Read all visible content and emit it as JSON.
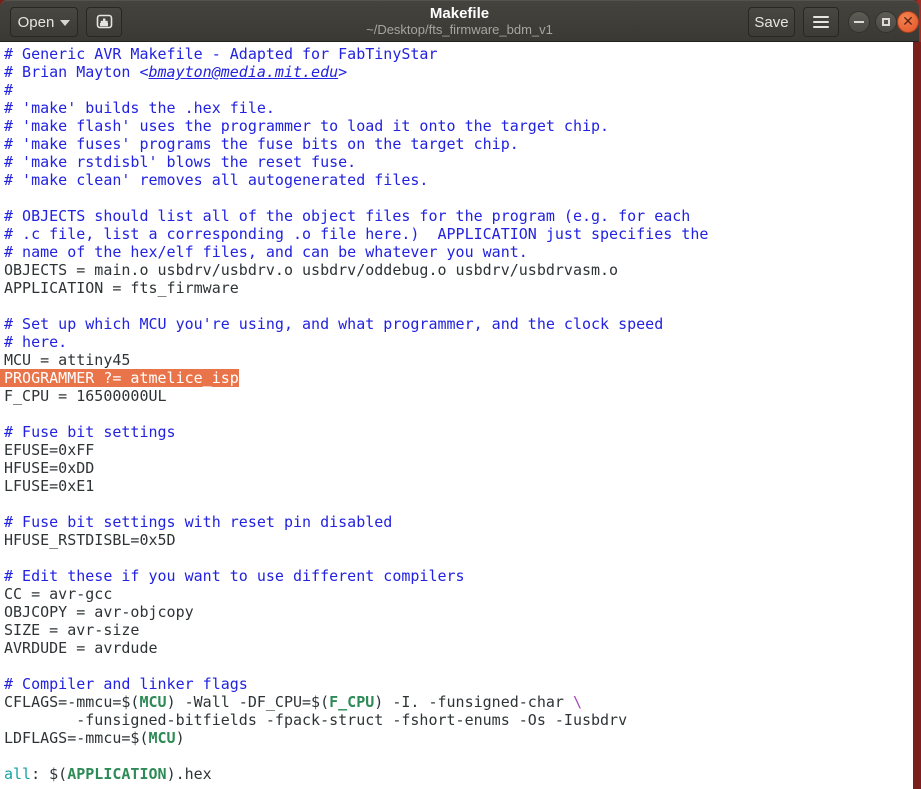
{
  "window": {
    "title": "Makefile",
    "subtitle": "~/Desktop/fts_firmware_bdm_v1",
    "open_button_label": "Open",
    "save_button_label": "Save",
    "toolbar_icons": [
      "caret-down-icon",
      "new-document-icon",
      "menu-icon"
    ],
    "window_controls": [
      "minimize",
      "maximize",
      "close"
    ]
  },
  "colors": {
    "comment_color": "#2222e0",
    "plain_color": "#2e3436",
    "var_color": "#2e8b57",
    "target_color": "#17a2a2",
    "esc_color": "#a347ba",
    "selection_color": "#ea744a",
    "desktop_red": "#7a201a",
    "header_bg": "#3d3b36",
    "close_button_orange": "#e8633f"
  },
  "code": {
    "selected_text": "PROGRAMMER ?= atmelice_isp",
    "lines": [
      [
        {
          "t": "# Generic AVR Makefile - Adapted for FabTinyStar",
          "c": "comment"
        }
      ],
      [
        {
          "t": "# Brian Mayton <",
          "c": "comment"
        },
        {
          "t": "bmayton@media.mit.edu",
          "c": "email"
        },
        {
          "t": ">",
          "c": "comment"
        }
      ],
      [
        {
          "t": "#",
          "c": "comment"
        }
      ],
      [
        {
          "t": "# 'make' builds the .hex file.",
          "c": "comment"
        }
      ],
      [
        {
          "t": "# 'make flash' uses the programmer to load it onto the target chip.",
          "c": "comment"
        }
      ],
      [
        {
          "t": "# 'make fuses' programs the fuse bits on the target chip.",
          "c": "comment"
        }
      ],
      [
        {
          "t": "# 'make rstdisbl' blows the reset fuse.",
          "c": "comment"
        }
      ],
      [
        {
          "t": "# 'make clean' removes all autogenerated files.",
          "c": "comment"
        }
      ],
      [],
      [
        {
          "t": "# OBJECTS should list all of the object files for the program (e.g. for each",
          "c": "comment"
        }
      ],
      [
        {
          "t": "# .c file, list a corresponding .o file here.)  APPLICATION just specifies the",
          "c": "comment"
        }
      ],
      [
        {
          "t": "# name of the hex/elf files, and can be whatever you want.",
          "c": "comment"
        }
      ],
      [
        {
          "t": "OBJECTS = main.o usbdrv/usbdrv.o usbdrv/oddebug.o usbdrv/usbdrvasm.o",
          "c": "plain"
        }
      ],
      [
        {
          "t": "APPLICATION = fts_firmware",
          "c": "plain"
        }
      ],
      [],
      [
        {
          "t": "# Set up which MCU you're using, and what programmer, and the clock speed",
          "c": "comment"
        }
      ],
      [
        {
          "t": "# here.",
          "c": "comment"
        }
      ],
      [
        {
          "t": "MCU = attiny45",
          "c": "plain"
        }
      ],
      [
        {
          "t": "PROGRAMMER ?= atmelice_isp",
          "c": "hl"
        }
      ],
      [
        {
          "t": "F_CPU = 16500000UL",
          "c": "plain"
        }
      ],
      [],
      [
        {
          "t": "# Fuse bit settings",
          "c": "comment"
        }
      ],
      [
        {
          "t": "EFUSE=0xFF",
          "c": "plain"
        }
      ],
      [
        {
          "t": "HFUSE=0xDD",
          "c": "plain"
        }
      ],
      [
        {
          "t": "LFUSE=0xE1",
          "c": "plain"
        }
      ],
      [],
      [
        {
          "t": "# Fuse bit settings with reset pin disabled",
          "c": "comment"
        }
      ],
      [
        {
          "t": "HFUSE_RSTDISBL=0x5D",
          "c": "plain"
        }
      ],
      [],
      [
        {
          "t": "# Edit these if you want to use different compilers",
          "c": "comment"
        }
      ],
      [
        {
          "t": "CC = avr-gcc",
          "c": "plain"
        }
      ],
      [
        {
          "t": "OBJCOPY = avr-objcopy",
          "c": "plain"
        }
      ],
      [
        {
          "t": "SIZE = avr-size",
          "c": "plain"
        }
      ],
      [
        {
          "t": "AVRDUDE = avrdude",
          "c": "plain"
        }
      ],
      [],
      [
        {
          "t": "# Compiler and linker flags",
          "c": "comment"
        }
      ],
      [
        {
          "t": "CFLAGS=-mmcu=$(",
          "c": "plain"
        },
        {
          "t": "MCU",
          "c": "var"
        },
        {
          "t": ") -Wall -DF_CPU=$(",
          "c": "plain"
        },
        {
          "t": "F_CPU",
          "c": "var"
        },
        {
          "t": ") -I. -funsigned-char ",
          "c": "plain"
        },
        {
          "t": "\\",
          "c": "esc"
        }
      ],
      [
        {
          "t": "        -funsigned-bitfields -fpack-struct -fshort-enums -Os -Iusbdrv",
          "c": "plain"
        }
      ],
      [
        {
          "t": "LDFLAGS=-mmcu=$(",
          "c": "plain"
        },
        {
          "t": "MCU",
          "c": "var"
        },
        {
          "t": ")",
          "c": "plain"
        }
      ],
      [],
      [
        {
          "t": "all",
          "c": "target"
        },
        {
          "t": ": $(",
          "c": "plain"
        },
        {
          "t": "APPLICATION",
          "c": "var"
        },
        {
          "t": ").hex",
          "c": "plain"
        }
      ]
    ]
  }
}
